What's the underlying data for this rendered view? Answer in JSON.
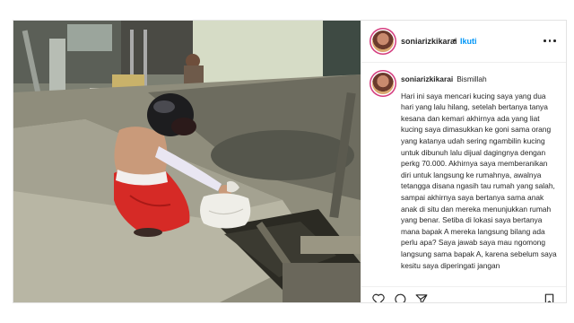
{
  "post": {
    "username": "soniarizkikarai",
    "follow_label": "Ikuti",
    "header_separator": "•",
    "caption_opening": "Bismillah",
    "caption_body": "Hari ini saya mencari kucing saya yang dua hari yang lalu hilang, setelah bertanya tanya kesana dan kemari akhirnya ada yang liat kucing saya dimasukkan ke goni sama orang yang katanya udah sering ngambilin kucing untuk dibunuh lalu dijual dagingnya dengan perkg 70.000. Akhirnya saya memberanikan diri untuk langsung ke rumahnya, awalnya tetangga disana ngasih tau rumah yang salah, sampai akhirnya saya bertanya sama anak anak di situ dan mereka menunjukkan rumah yang benar. Setiba di lokasi saya bertanya mana bapak A mereka langsung bilang ada perlu apa? Saya jawab saya mau ngomong langsung sama bapak A, karena sebelum saya kesitu saya diperingati jangan"
  },
  "icons": {
    "more": "more-options-icon",
    "like": "heart-icon",
    "comment": "comment-icon",
    "share": "share-icon",
    "save": "bookmark-icon"
  },
  "colors": {
    "link": "#0095f6",
    "text": "#262626",
    "story_ring": "#d43c7e"
  }
}
